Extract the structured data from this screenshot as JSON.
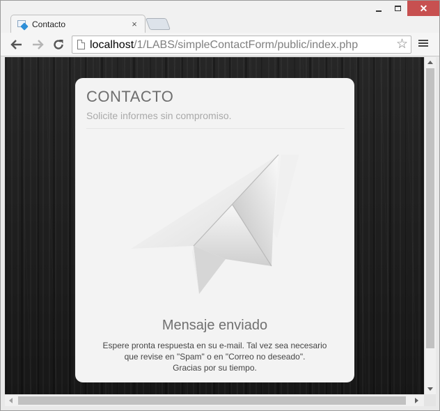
{
  "browser": {
    "tab_title": "Contacto",
    "tab_close": "×",
    "close_symbol": "✕",
    "url_host": "localhost",
    "url_path": "/1/LABS/simpleContactForm/public/index.php",
    "star_symbol": "☆"
  },
  "page": {
    "title": "CONTACTO",
    "subtitle": "Solicite informes sin compromiso.",
    "message_title": "Mensaje enviado",
    "message_lines": [
      "Espere pronta respuesta en su e-mail. Tal vez sea necesario",
      "que revise en \"Spam\" o en \"Correo no deseado\".",
      "Gracias por su tiempo."
    ]
  },
  "icons": {
    "favicon": "page-arrow-icon",
    "back": "arrow-left-icon",
    "forward": "arrow-right-icon",
    "reload": "reload-icon",
    "bookmark": "star-icon",
    "menu": "hamburger-menu-icon",
    "illustration": "paper-plane-icon"
  },
  "colors": {
    "close_button": "#c75050",
    "card_background": "#f3f3f3",
    "page_background": "#1f1f1f"
  }
}
